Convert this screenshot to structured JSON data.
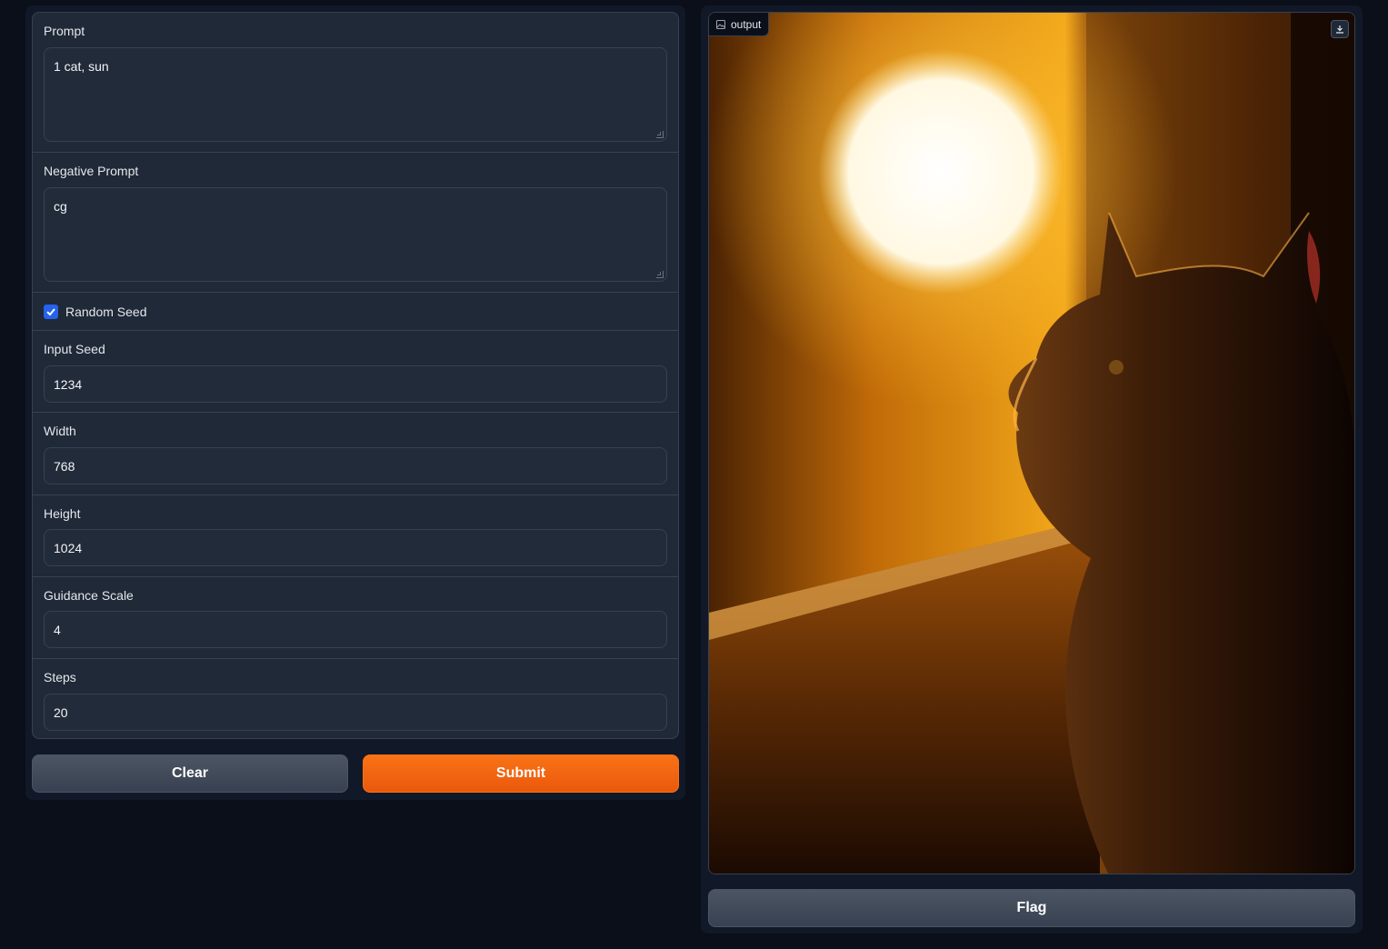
{
  "form": {
    "prompt": {
      "label": "Prompt",
      "value": "1 cat, sun"
    },
    "negative_prompt": {
      "label": "Negative Prompt",
      "value": "cg"
    },
    "random_seed": {
      "label": "Random Seed",
      "checked": true
    },
    "input_seed": {
      "label": "Input Seed",
      "value": "1234"
    },
    "width": {
      "label": "Width",
      "value": "768"
    },
    "height": {
      "label": "Height",
      "value": "1024"
    },
    "guidance_scale": {
      "label": "Guidance Scale",
      "value": "4"
    },
    "steps": {
      "label": "Steps",
      "value": "20"
    }
  },
  "actions": {
    "clear_label": "Clear",
    "submit_label": "Submit"
  },
  "output": {
    "label": "output",
    "icons": [
      "image-icon",
      "download-icon"
    ],
    "flag_label": "Flag"
  },
  "colors": {
    "background": "#0b0f19",
    "panel": "#111827",
    "block": "#1f2937",
    "border": "#374151",
    "accent_primary": "#f97316",
    "checkbox": "#2563eb"
  }
}
